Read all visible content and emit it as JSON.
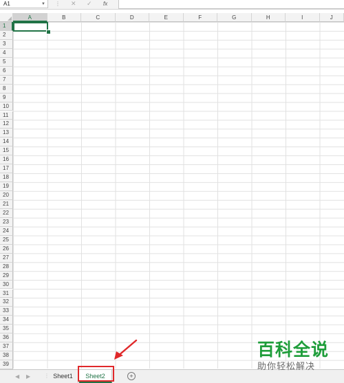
{
  "formula_bar": {
    "name_box": "A1",
    "cancel_icon": "x-icon",
    "enter_icon": "check-icon",
    "function_label": "fx",
    "formula_value": ""
  },
  "columns": [
    "A",
    "B",
    "C",
    "D",
    "E",
    "F",
    "G",
    "H",
    "I",
    "J"
  ],
  "rows": [
    "1",
    "2",
    "3",
    "4",
    "5",
    "6",
    "7",
    "8",
    "9",
    "10",
    "11",
    "12",
    "13",
    "14",
    "15",
    "16",
    "17",
    "18",
    "19",
    "20",
    "21",
    "22",
    "23",
    "24",
    "25",
    "26",
    "27",
    "28",
    "29",
    "30",
    "31",
    "32",
    "33",
    "34",
    "35",
    "36",
    "37",
    "38",
    "39"
  ],
  "active_cell": {
    "column": "A",
    "row": "1"
  },
  "sheet_tabs": {
    "tabs": [
      {
        "label": "Sheet1",
        "active": false
      },
      {
        "label": "Sheet2",
        "active": true
      }
    ],
    "add_sheet_label": "+",
    "nav_prev": "◀",
    "nav_next": "▶"
  },
  "annotation": {
    "highlight_color": "#e0282a",
    "arrow_color": "#e0282a"
  },
  "watermark": {
    "title": "百科全说",
    "subtitle": "助你轻松解决"
  },
  "colors": {
    "accent": "#217346",
    "watermark_green": "#1e9d3a"
  }
}
